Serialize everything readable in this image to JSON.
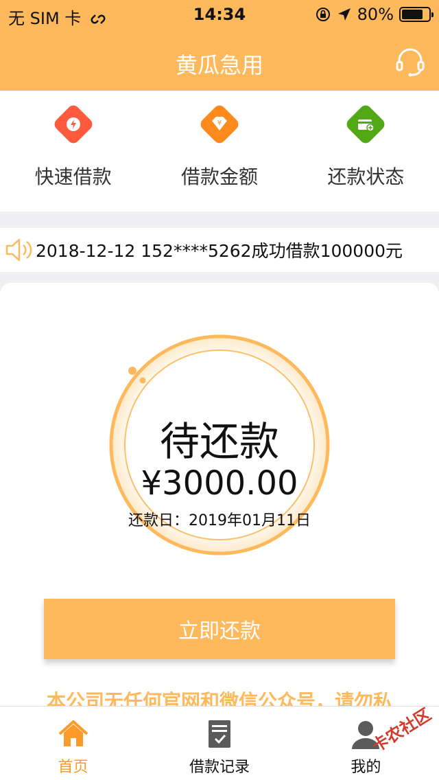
{
  "statusbar": {
    "carrier": "无 SIM 卡",
    "time": "14:34",
    "battery": "80%",
    "battery_level": 0.8
  },
  "navbar": {
    "title": "黄瓜急用"
  },
  "quick_actions": [
    {
      "label": "快速借款",
      "color": "#fd5a3e"
    },
    {
      "label": "借款金额",
      "color": "#fd8a1a"
    },
    {
      "label": "还款状态",
      "color": "#52a915"
    }
  ],
  "notice": {
    "text": "2018-12-12 152****5262成功借款100000元"
  },
  "loan": {
    "status": "待还款",
    "amount": "¥3000.00",
    "due_date": "还款日：2019年01月11日"
  },
  "repay_button": "立即还款",
  "warning": "本公司无任何官网和微信公众号，请勿私",
  "tabs": [
    {
      "label": "首页",
      "active": true
    },
    {
      "label": "借款记录",
      "active": false
    },
    {
      "label": "我的",
      "active": false
    }
  ],
  "watermark": "卡农社区",
  "colors": {
    "brand": "#fdb95c",
    "active_tab": "#fd9a2a"
  }
}
